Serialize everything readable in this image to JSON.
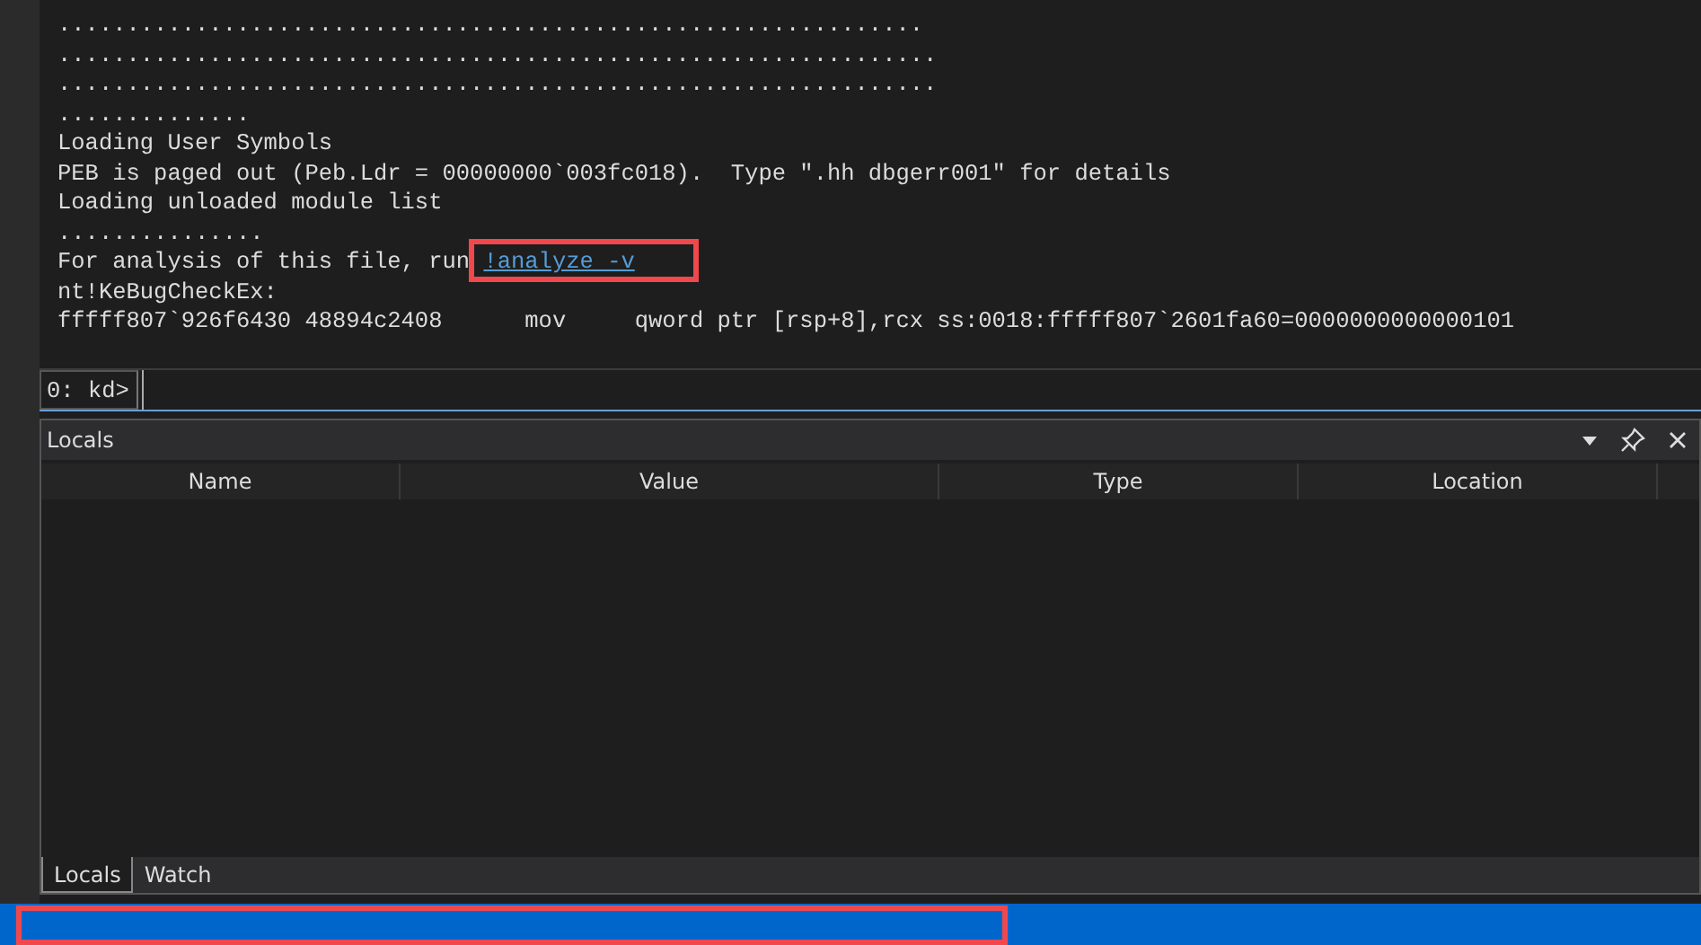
{
  "output_lines": [
    {
      "text": "..............................................................."
    },
    {
      "text": "................................................................"
    },
    {
      "text": "................................................................"
    },
    {
      "text": ".............."
    },
    {
      "text": "Loading User Symbols"
    },
    {
      "text": "PEB is paged out (Peb.Ldr = 00000000`003fc018).  Type \".hh dbgerr001\" for details"
    },
    {
      "text": "Loading unloaded module list"
    },
    {
      "text": "..............."
    },
    {
      "text": "For analysis of this file, run ",
      "link": "!analyze -v"
    },
    {
      "text": "nt!KeBugCheckEx:"
    },
    {
      "text": "fffff807`926f6430 48894c2408      mov     qword ptr [rsp+8],rcx ss:0018:fffff807`2601fa60=0000000000000101"
    }
  ],
  "command": {
    "prompt": "0: kd>"
  },
  "locals_panel": {
    "title": "Locals",
    "columns": [
      "Name",
      "Value",
      "Type",
      "Location"
    ],
    "tabs": [
      {
        "label": "Locals",
        "selected": true
      },
      {
        "label": "Watch",
        "selected": false
      }
    ]
  }
}
